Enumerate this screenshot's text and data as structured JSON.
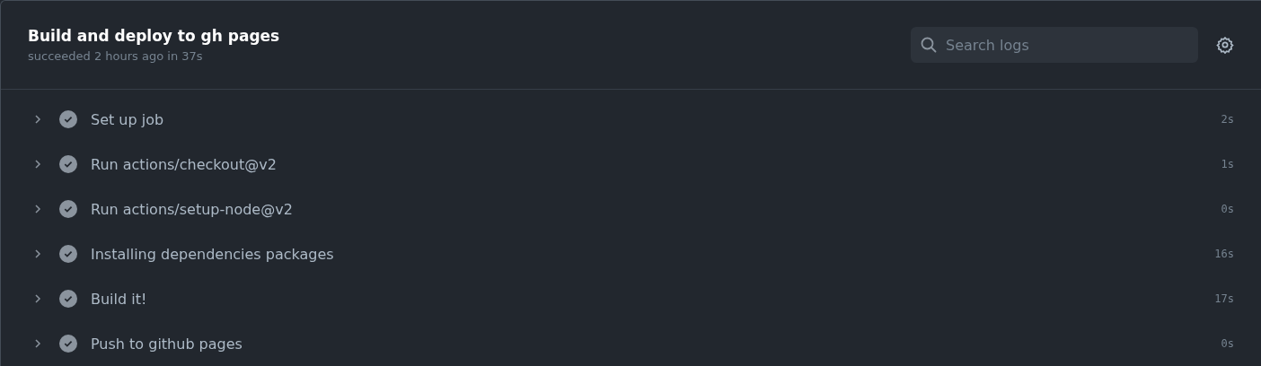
{
  "job": {
    "title": "Build and deploy to gh pages",
    "summary": "succeeded 2 hours ago in 37s"
  },
  "search": {
    "placeholder": "Search logs"
  },
  "steps": [
    {
      "name": "Set up job",
      "duration": "2s",
      "succeeded": true,
      "expanded": false
    },
    {
      "name": "Run actions/checkout@v2",
      "duration": "1s",
      "succeeded": true,
      "expanded": false
    },
    {
      "name": "Run actions/setup-node@v2",
      "duration": "0s",
      "succeeded": true,
      "expanded": false
    },
    {
      "name": "Installing dependencies packages",
      "duration": "16s",
      "succeeded": true,
      "expanded": false
    },
    {
      "name": "Build it!",
      "duration": "17s",
      "succeeded": true,
      "expanded": false
    },
    {
      "name": "Push to github pages",
      "duration": "0s",
      "succeeded": true,
      "expanded": false
    }
  ]
}
